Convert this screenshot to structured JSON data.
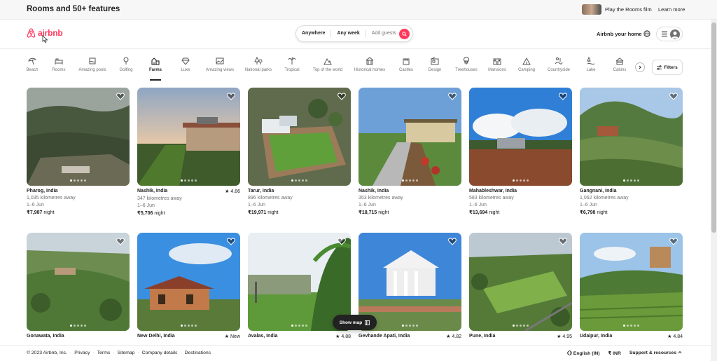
{
  "promo": {
    "title": "Rooms and 50+ features",
    "film_link": "Play the Rooms film",
    "learn_more": "Learn more"
  },
  "header": {
    "logo_text": "airbnb",
    "host_link": "Airbnb your home"
  },
  "search": {
    "anywhere": "Anywhere",
    "any_week": "Any week",
    "guests_placeholder": "Add guests"
  },
  "categories": [
    {
      "label": "Beach",
      "icon": "beach-umbrella-icon"
    },
    {
      "label": "Rooms",
      "icon": "bed-icon"
    },
    {
      "label": "Amazing pools",
      "icon": "pool-icon"
    },
    {
      "label": "Golfing",
      "icon": "golf-icon"
    },
    {
      "label": "Farms",
      "icon": "barn-icon"
    },
    {
      "label": "Luxe",
      "icon": "diamond-icon"
    },
    {
      "label": "Amazing views",
      "icon": "view-icon"
    },
    {
      "label": "National parks",
      "icon": "park-icon"
    },
    {
      "label": "Tropical",
      "icon": "palm-icon"
    },
    {
      "label": "Top of the world",
      "icon": "mountain-icon"
    },
    {
      "label": "Historical homes",
      "icon": "historic-home-icon"
    },
    {
      "label": "Castles",
      "icon": "castle-icon"
    },
    {
      "label": "Design",
      "icon": "design-icon"
    },
    {
      "label": "Treehouses",
      "icon": "treehouse-icon"
    },
    {
      "label": "Mansions",
      "icon": "mansion-icon"
    },
    {
      "label": "Camping",
      "icon": "tent-icon"
    },
    {
      "label": "Countryside",
      "icon": "countryside-icon"
    },
    {
      "label": "Lake",
      "icon": "lake-icon"
    },
    {
      "label": "Cabins",
      "icon": "cabin-icon"
    }
  ],
  "active_category": "Farms",
  "filters_label": "Filters",
  "listings": [
    {
      "location": "Pharog, India",
      "rating": "",
      "distance": "1,035 kilometres away",
      "dates": "1–6 Jun",
      "price": "₹7,987",
      "price_unit": "night"
    },
    {
      "location": "Nashik, India",
      "rating": "4.86",
      "distance": "347 kilometres away",
      "dates": "1–6 Jun",
      "price": "₹5,706",
      "price_unit": "night"
    },
    {
      "location": "Tarur, India",
      "rating": "",
      "distance": "896 kilometres away",
      "dates": "1–6 Jun",
      "price": "₹19,971",
      "price_unit": "night"
    },
    {
      "location": "Nashik, India",
      "rating": "",
      "distance": "353 kilometres away",
      "dates": "1–6 Jun",
      "price": "₹18,715",
      "price_unit": "night"
    },
    {
      "location": "Mahableshwar, India",
      "rating": "",
      "distance": "583 kilometres away",
      "dates": "1–6 Jun",
      "price": "₹13,694",
      "price_unit": "night"
    },
    {
      "location": "Gangnani, India",
      "rating": "",
      "distance": "1,062 kilometres away",
      "dates": "1–6 Jun",
      "price": "₹6,798",
      "price_unit": "night"
    },
    {
      "location": "Gonawata, India",
      "rating": "",
      "distance": "",
      "dates": "",
      "price": "",
      "price_unit": ""
    },
    {
      "location": "New Delhi, India",
      "rating": "New",
      "distance": "",
      "dates": "",
      "price": "",
      "price_unit": ""
    },
    {
      "location": "Avalas, India",
      "rating": "4.88",
      "distance": "",
      "dates": "",
      "price": "",
      "price_unit": ""
    },
    {
      "location": "Gevhande Apati, India",
      "rating": "4.82",
      "distance": "",
      "dates": "",
      "price": "",
      "price_unit": ""
    },
    {
      "location": "Pune, India",
      "rating": "4.95",
      "distance": "",
      "dates": "",
      "price": "",
      "price_unit": ""
    },
    {
      "location": "Udaipur, India",
      "rating": "4.84",
      "distance": "",
      "dates": "",
      "price": "",
      "price_unit": ""
    }
  ],
  "show_map_label": "Show map",
  "footer": {
    "copyright": "© 2023 Airbnb, Inc.",
    "links": [
      "Privacy",
      "Terms",
      "Sitemap",
      "Company details",
      "Destinations"
    ],
    "language": "English (IN)",
    "currency": "₹ INR",
    "support": "Support & resources"
  },
  "colors": {
    "brand": "#ff385c",
    "text": "#222222",
    "muted": "#717171"
  }
}
